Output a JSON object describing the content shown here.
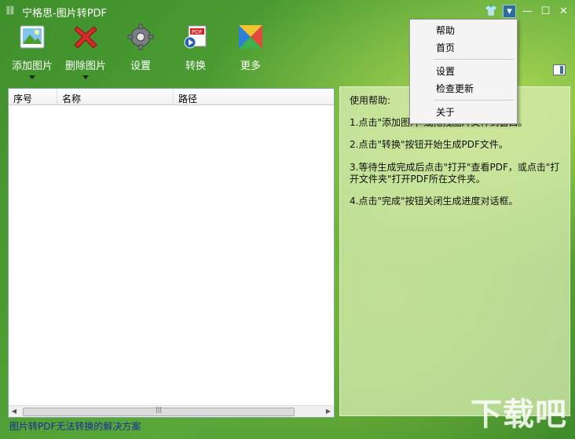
{
  "window": {
    "title": "宁格思-图片转PDF",
    "controls": [
      "skin-icon",
      "menu-down-icon",
      "minimize-icon",
      "maximize-icon",
      "close-icon"
    ]
  },
  "toolbar": {
    "add": "添加图片",
    "delete": "删除图片",
    "settings": "设置",
    "convert": "转换",
    "more": "更多"
  },
  "table": {
    "columns": [
      "序号",
      "名称",
      "路径"
    ]
  },
  "help": {
    "title": "使用帮助:",
    "steps": [
      "1.点击\"添加图片\"或拖拽图片文件到窗口。",
      "2.点击\"转换\"按钮开始生成PDF文件。",
      "3.等待生成完成后点击\"打开\"查看PDF，或点击\"打开文件夹\"打开PDF所在文件夹。",
      "4.点击\"完成\"按钮关闭生成进度对话框。"
    ]
  },
  "menu": {
    "items": [
      "帮助",
      "首页",
      "设置",
      "检查更新",
      "关于"
    ]
  },
  "footer": {
    "link": "图片转PDF无法转换的解决方案"
  },
  "watermark": "下载吧"
}
